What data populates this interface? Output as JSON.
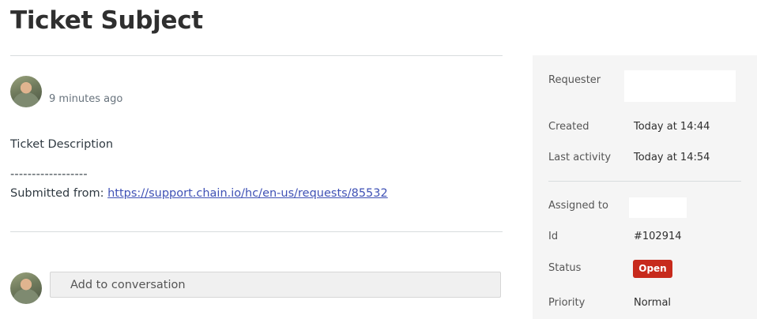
{
  "ticket": {
    "subject": "Ticket Subject",
    "time_ago": "9 minutes ago",
    "description": "Ticket Description",
    "separator": "------------------",
    "submitted_prefix": "Submitted from: ",
    "submitted_link": "https://support.chain.io/hc/en-us/requests/85532"
  },
  "conversation": {
    "placeholder": "Add to conversation"
  },
  "details": {
    "requester_label": "Requester",
    "created_label": "Created",
    "created_value": "Today at 14:44",
    "last_activity_label": "Last activity",
    "last_activity_value": "Today at 14:54",
    "assigned_label": "Assigned to",
    "id_label": "Id",
    "id_value": "#102914",
    "status_label": "Status",
    "status_value": "Open",
    "priority_label": "Priority",
    "priority_value": "Normal"
  },
  "colors": {
    "status_open": "#c72a1c",
    "link": "#3f51b5",
    "panel_bg": "#f5f5f5"
  }
}
